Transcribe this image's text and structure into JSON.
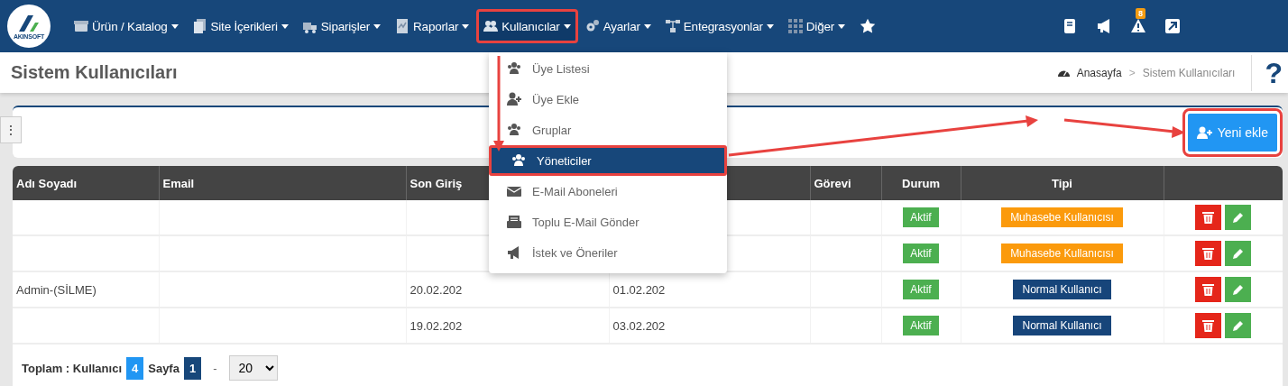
{
  "logo": {
    "text": "AKINSOFT"
  },
  "nav": {
    "items": [
      {
        "label": "Ürün / Katalog",
        "dropdown": true,
        "highlighted": false
      },
      {
        "label": "Site İçerikleri",
        "dropdown": true,
        "highlighted": false
      },
      {
        "label": "Siparişler",
        "dropdown": true,
        "highlighted": false
      },
      {
        "label": "Raporlar",
        "dropdown": true,
        "highlighted": false
      },
      {
        "label": "Kullanıcılar",
        "dropdown": true,
        "highlighted": true
      },
      {
        "label": "Ayarlar",
        "dropdown": true,
        "highlighted": false
      },
      {
        "label": "Entegrasyonlar",
        "dropdown": true,
        "highlighted": false
      },
      {
        "label": "Diğer",
        "dropdown": true,
        "highlighted": false
      }
    ],
    "alerts_badge": "8"
  },
  "dropdown_menu": {
    "items": [
      {
        "label": "Üye Listesi",
        "selected": false
      },
      {
        "label": "Üye Ekle",
        "selected": false
      },
      {
        "label": "Gruplar",
        "selected": false
      },
      {
        "label": "Yöneticiler",
        "selected": true
      },
      {
        "label": "E-Mail Aboneleri",
        "selected": false
      },
      {
        "label": "Toplu E-Mail Gönder",
        "selected": false
      },
      {
        "label": "İstek ve Öneriler",
        "selected": false
      }
    ]
  },
  "page": {
    "title": "Sistem Kullanıcıları",
    "breadcrumb": [
      "Anasayfa",
      "Sistem Kullanıcıları"
    ],
    "breadcrumb_separator": ">",
    "help": "?"
  },
  "toolbar": {
    "handle": "⋮",
    "new_button": {
      "label": "Yeni ekle",
      "highlighted": true
    }
  },
  "table": {
    "columns": [
      "Adı Soyadı",
      "Email",
      "Son Giriş",
      null,
      "Görevi",
      "Durum",
      "Tipi",
      null
    ],
    "rows": [
      {
        "status": "Aktif",
        "type": "Muhasebe Kullanıcısı",
        "color": "#fb9a0c"
      },
      {
        "status": "Aktif",
        "type": "Muhasebe Kullanıcısı",
        "color": "#fb9a0c"
      },
      {
        "name": "Admin-(SİLME)",
        "last_login": "20.02.202",
        "column_4": "01.02.202",
        "status": "Aktif",
        "type": "Normal Kullanıcı",
        "color": "#17457a"
      },
      {
        "last_login": "19.02.202",
        "column_4": "03.02.202",
        "status": "Aktif",
        "type": "Normal Kullanıcı",
        "color": "#17457a"
      }
    ]
  },
  "footer": {
    "total_label": "Toplam : Kullanıcı",
    "total": "4",
    "page_label": "Sayfa",
    "page": "1",
    "separator": "-",
    "page_size": "20"
  }
}
